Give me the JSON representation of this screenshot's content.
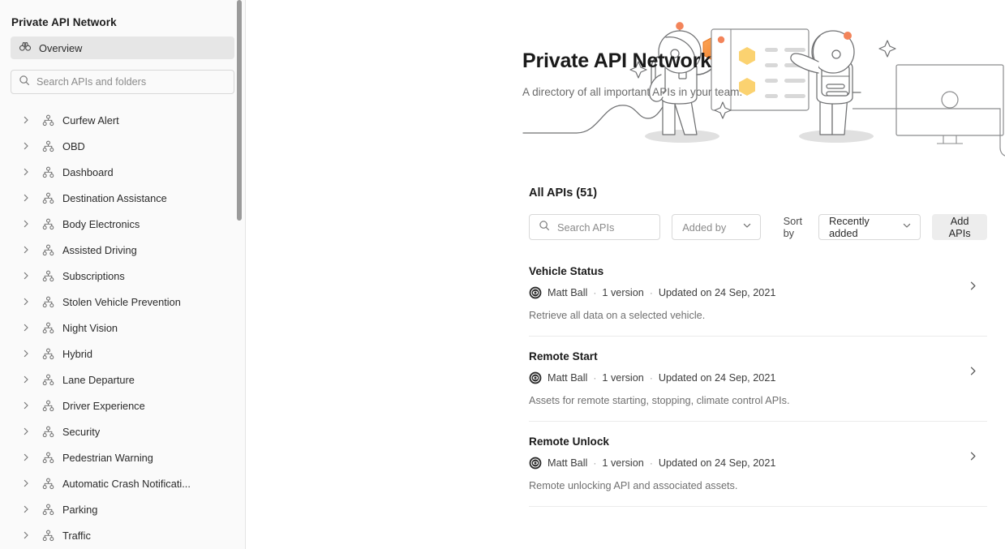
{
  "sidebar": {
    "title": "Private API Network",
    "overview": {
      "label": "Overview",
      "icon": "binoculars-icon"
    },
    "search": {
      "placeholder": "Search APIs and folders",
      "value": "",
      "icon": "search-icon"
    },
    "items": [
      {
        "label": "Curfew Alert",
        "icon": "api-network-icon"
      },
      {
        "label": "OBD",
        "icon": "api-network-icon"
      },
      {
        "label": "Dashboard",
        "icon": "api-network-icon"
      },
      {
        "label": "Destination Assistance",
        "icon": "api-network-icon"
      },
      {
        "label": "Body Electronics",
        "icon": "api-network-icon"
      },
      {
        "label": "Assisted Driving",
        "icon": "api-network-icon"
      },
      {
        "label": "Subscriptions",
        "icon": "api-network-icon"
      },
      {
        "label": "Stolen Vehicle Prevention",
        "icon": "api-network-icon"
      },
      {
        "label": "Night Vision",
        "icon": "api-network-icon"
      },
      {
        "label": "Hybrid",
        "icon": "api-network-icon"
      },
      {
        "label": "Lane Departure",
        "icon": "api-network-icon"
      },
      {
        "label": "Driver Experience",
        "icon": "api-network-icon"
      },
      {
        "label": "Security",
        "icon": "api-network-icon"
      },
      {
        "label": "Pedestrian Warning",
        "icon": "api-network-icon"
      },
      {
        "label": "Automatic Crash Notificati...",
        "icon": "api-network-icon"
      },
      {
        "label": "Parking",
        "icon": "api-network-icon"
      },
      {
        "label": "Traffic",
        "icon": "api-network-icon"
      }
    ]
  },
  "hero": {
    "title": "Private API Network",
    "subtitle": "A directory of all important APIs in your team.",
    "illustration": "astronauts-board-illustration"
  },
  "main": {
    "section_title": "All APIs (51)",
    "search": {
      "placeholder": "Search APIs",
      "value": "",
      "icon": "search-icon"
    },
    "added_by": {
      "placeholder": "Added by",
      "value": "Added by",
      "options": [
        "Added by"
      ]
    },
    "sort_by_label": "Sort by",
    "sort_by": {
      "value": "Recently added",
      "options": [
        "Recently added"
      ]
    },
    "add_apis_label": "Add APIs",
    "rows": [
      {
        "name": "Vehicle Status",
        "author": "Matt Ball",
        "versions": "1 version",
        "updated": "Updated on 24 Sep, 2021",
        "description": "Retrieve all data on a selected vehicle.",
        "separator": "·"
      },
      {
        "name": "Remote Start",
        "author": "Matt Ball",
        "versions": "1 version",
        "updated": "Updated on 24 Sep, 2021",
        "description": "Assets for remote starting, stopping, climate control APIs.",
        "separator": "·"
      },
      {
        "name": "Remote Unlock",
        "author": "Matt Ball",
        "versions": "1 version",
        "updated": "Updated on 24 Sep, 2021",
        "description": "Remote unlocking API and associated assets.",
        "separator": "·"
      }
    ]
  },
  "colors": {
    "sidebar_bg": "#fafafa",
    "accent_orange": "#f58a3c",
    "accent_yellow": "#fbd270",
    "text_primary": "#1a1a1a",
    "text_muted": "#707070",
    "button_bg": "#ededed",
    "selected_bg": "#e6e6e6"
  }
}
